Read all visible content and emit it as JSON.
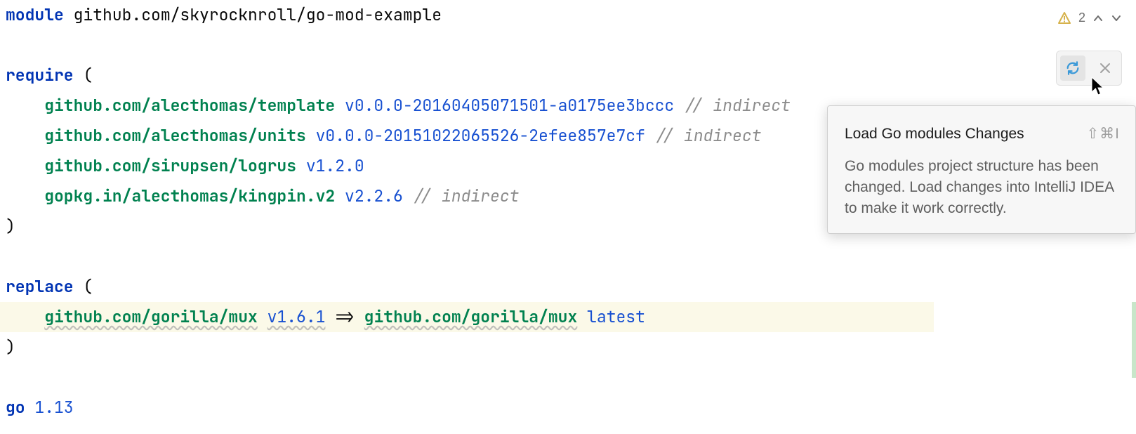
{
  "inspections": {
    "count": "2"
  },
  "code": {
    "module_kw": "module",
    "module_path": "github.com/skyrocknroll/go-mod-example",
    "require_kw": "require",
    "open_paren": "(",
    "close_paren": ")",
    "deps": [
      {
        "path": "github.com/alecthomas/template",
        "ver": "v0.0.0-20160405071501-a0175ee3bccc",
        "comment": "// indirect"
      },
      {
        "path": "github.com/alecthomas/units",
        "ver": "v0.0.0-20151022065526-2efee857e7cf",
        "comment": "// indirect"
      },
      {
        "path": "github.com/sirupsen/logrus",
        "ver": "v1.2.0",
        "comment": ""
      },
      {
        "path": "gopkg.in/alecthomas/kingpin.v2",
        "ver": "v2.2.6",
        "comment": "// indirect"
      }
    ],
    "replace_kw": "replace",
    "replace": {
      "from_path": "github.com/gorilla/mux",
      "from_ver": "v1.6.1",
      "arrow": "=>",
      "to_path": "github.com/gorilla/mux",
      "to_ver": "latest"
    },
    "go_kw": "go",
    "go_ver": "1.13"
  },
  "tooltip": {
    "title": "Load Go modules Changes",
    "shortcut": "⇧⌘I",
    "body": "Go modules project structure has been changed. Load changes into IntelliJ IDEA to make it work correctly."
  }
}
